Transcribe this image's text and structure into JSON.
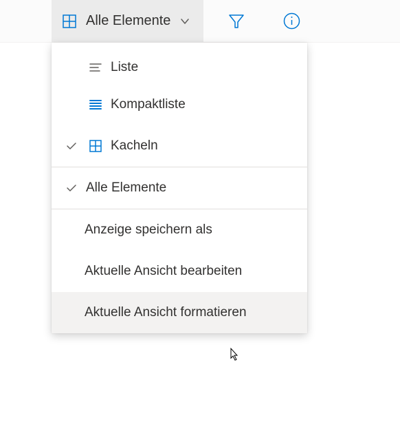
{
  "colors": {
    "accent": "#0078d4",
    "text": "#323130",
    "muted": "#605e5c"
  },
  "topbar": {
    "view_label": "Alle Elemente"
  },
  "menu": {
    "items": [
      {
        "label": "Liste"
      },
      {
        "label": "Kompaktliste"
      },
      {
        "label": "Kacheln"
      },
      {
        "label": "Alle Elemente"
      },
      {
        "label": "Anzeige speichern als"
      },
      {
        "label": "Aktuelle Ansicht bearbeiten"
      },
      {
        "label": "Aktuelle Ansicht formatieren"
      }
    ]
  }
}
